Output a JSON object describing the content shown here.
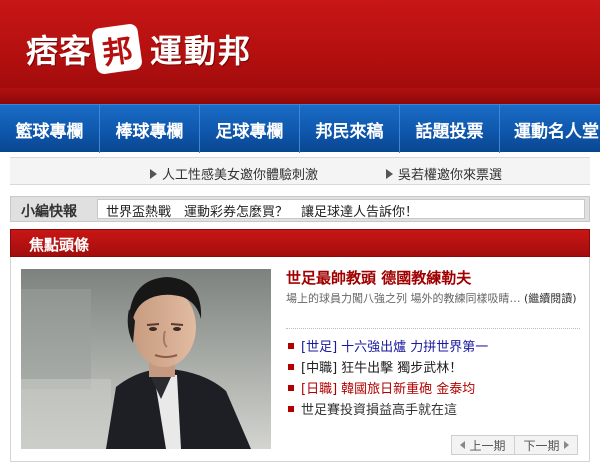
{
  "header": {
    "logo_part1": "痞客",
    "logo_badge": "邦",
    "logo_part2": "運動邦"
  },
  "nav": {
    "items": [
      {
        "label": "籃球專欄"
      },
      {
        "label": "棒球專欄"
      },
      {
        "label": "足球專欄"
      },
      {
        "label": "邦民來稿"
      },
      {
        "label": "話題投票"
      },
      {
        "label": "運動名人堂"
      }
    ]
  },
  "promo": {
    "links": [
      {
        "label": "人工性感美女邀你體驗刺激"
      },
      {
        "label": "吳若權邀你來票選"
      }
    ]
  },
  "quick_news": {
    "label": "小編快報",
    "text": "世界盃熱戰　運動彩券怎麼買？　讓足球達人告訴你！"
  },
  "focus": {
    "title": "焦點頭條",
    "headline": "世足最帥教頭 德國教練勒夫",
    "summary": "場上的球員力闖八強之列 場外的教練同樣吸睛…",
    "more": "(繼續閱讀)",
    "list": [
      {
        "tag": "[世足]",
        "text": "十六強出爐 力拼世界第一",
        "color": "#1a1a9e"
      },
      {
        "tag": "[中職]",
        "text": "狂牛出擊 獨步武林！",
        "color": "#222222"
      },
      {
        "tag": "[日職]",
        "text": "韓國旅日新重砲 金泰均",
        "color": "#b10000"
      },
      {
        "tag": "",
        "text": "世足賽投資損益高手就在這",
        "color": "#333333"
      }
    ],
    "pager": {
      "prev": "上一期",
      "next": "下一期"
    }
  },
  "colors": {
    "brand_red": "#b70f0f",
    "nav_blue": "#0f58ad",
    "headline_red": "#a00000"
  }
}
